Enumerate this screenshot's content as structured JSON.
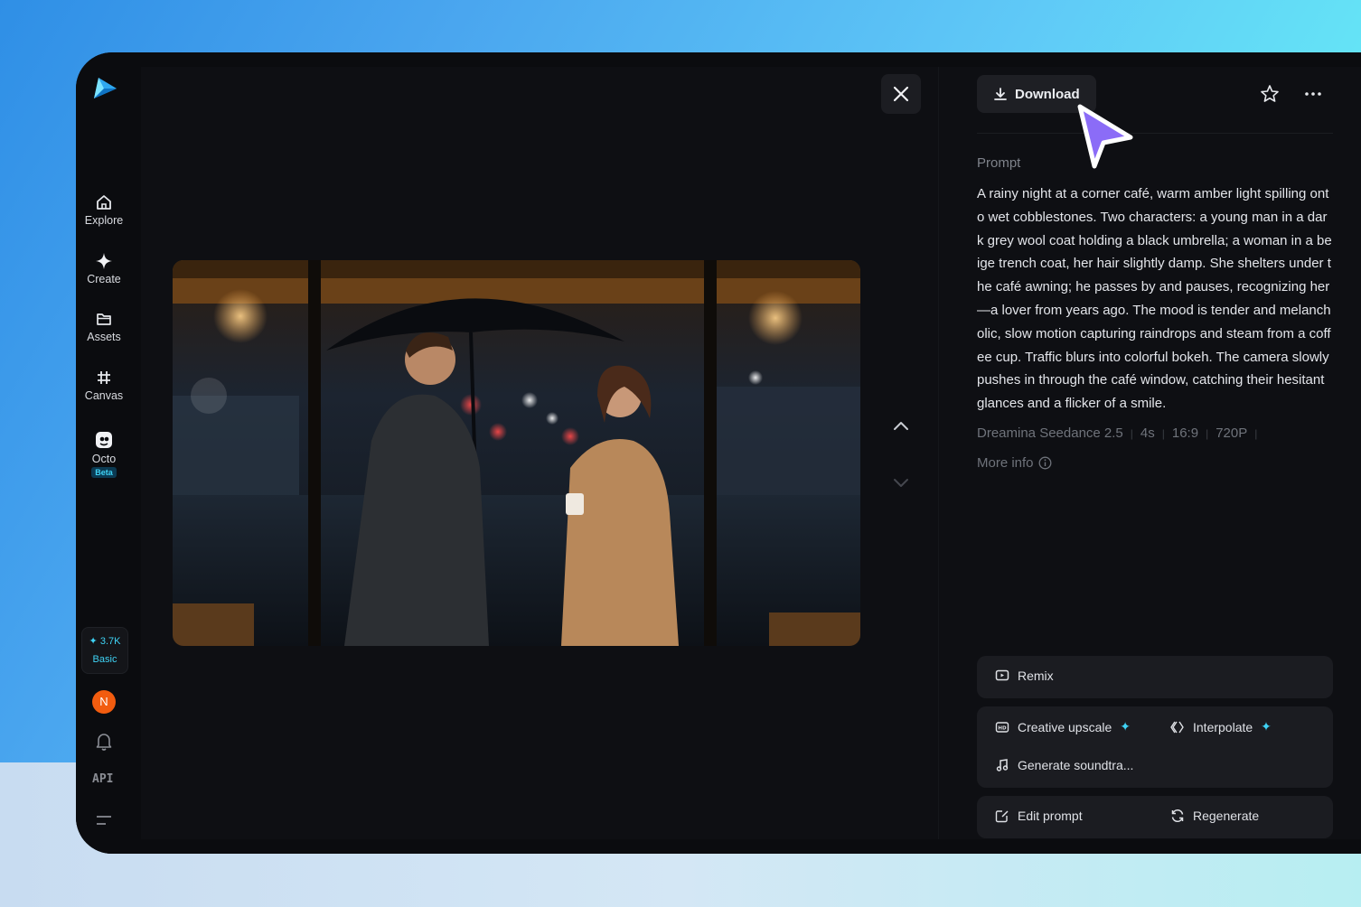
{
  "sidebar": {
    "items": [
      {
        "label": "Explore",
        "icon": "home-icon"
      },
      {
        "label": "Create",
        "icon": "sparkle-icon"
      },
      {
        "label": "Assets",
        "icon": "folder-icon"
      },
      {
        "label": "Canvas",
        "icon": "grid-icon"
      },
      {
        "label": "Octo",
        "icon": "octo-icon",
        "badge": "Beta"
      }
    ],
    "credits": {
      "amount": "✦ 3.7K",
      "plan": "Basic"
    },
    "avatar_initial": "N",
    "api_label": "API"
  },
  "viewer": {
    "media_description_icon": "video-frame"
  },
  "panel": {
    "download_label": "Download",
    "prompt_label": "Prompt",
    "prompt_text": "A rainy night at a corner café, warm amber light spilling onto wet cobblestones. Two characters: a young man in a dark grey wool coat holding a black umbrella; a woman in a beige trench coat, her hair slightly damp. She shelters under the café awning; he passes by and pauses, recognizing her—a lover from years ago. The mood is tender and melancholic, slow motion capturing raindrops and steam from a coffee cup. Traffic blurs into colorful bokeh. The camera slowly pushes in through the café window, catching their hesitant glances and a flicker of a smile.",
    "meta": {
      "model": "Dreamina Seedance 2.5",
      "duration": "4s",
      "ratio": "16:9",
      "resolution": "720P"
    },
    "more_info_label": "More info",
    "actions": {
      "remix": "Remix",
      "creative_upscale": "Creative upscale",
      "interpolate": "Interpolate",
      "generate_soundtrack": "Generate soundtra...",
      "edit_prompt": "Edit prompt",
      "regenerate": "Regenerate"
    }
  },
  "colors": {
    "accent": "#3fd3f5",
    "avatar": "#f25c0f",
    "cursor": "#8b6cf7"
  }
}
